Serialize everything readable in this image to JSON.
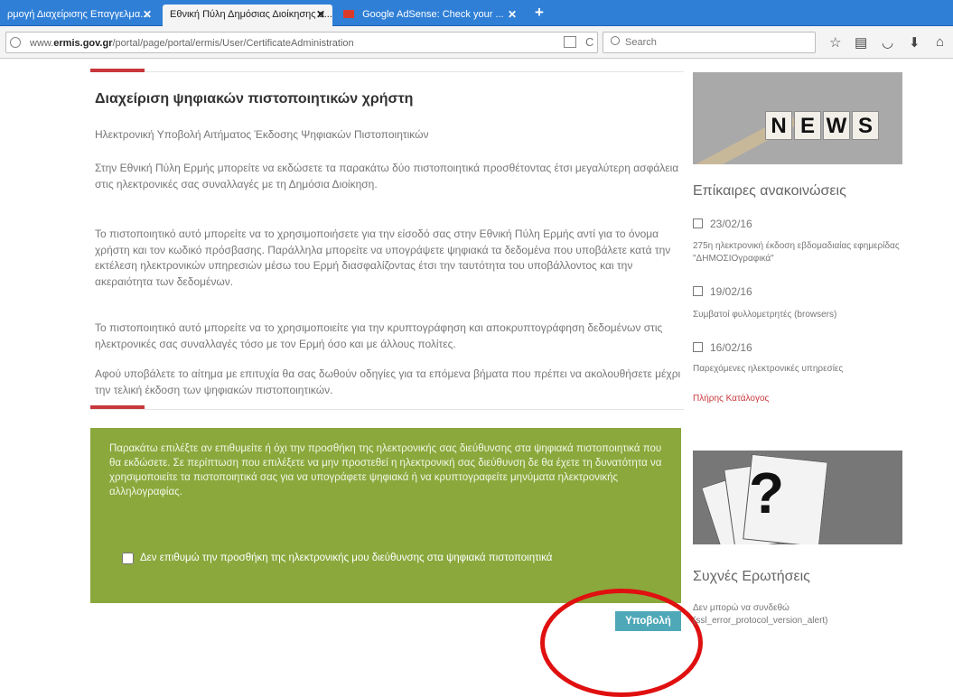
{
  "browser": {
    "tabs": [
      {
        "label": "ρμογή Διαχείρισης Επαγγελμα...",
        "active": false
      },
      {
        "label": "Εθνική Πύλη Δημόσιας Διοίκησης e...",
        "active": true
      },
      {
        "label": "Google AdSense: Check your ...",
        "active": false
      }
    ],
    "close_glyph": "✕",
    "new_tab_glyph": "+",
    "url_prefix": "www.",
    "url_domain": "ermis.gov.gr",
    "url_path": "/portal/page/portal/ermis/User/CertificateAdministration",
    "search_placeholder": "Search",
    "accent_color": "#2f7fd6"
  },
  "page": {
    "title": "Διαχείριση ψηφιακών πιστοποιητικών χρήστη",
    "subtitle": "Ηλεκτρονική Υποβολή Αιτήματος Έκδοσης Ψηφιακών Πιστοποιητικών",
    "paragraphs": [
      "Στην Εθνική Πύλη Ερμής μπορείτε να εκδώσετε τα παρακάτω δύο πιστοποιητικά προσθέτοντας έτσι μεγαλύτερη ασφάλεια στις ηλεκτρονικές σας συναλλαγές με τη Δημόσια Διοίκηση.",
      "Το πιστοποιητικό αυτό μπορείτε να το χρησιμοποιήσετε για την είσοδό σας στην Εθνική Πύλη Ερμής αντί για το όνομα χρήστη και τον κωδικό πρόσβασης. Παράλληλα μπορείτε να υπογράψετε ψηφιακά τα δεδομένα που υποβάλετε κατά την εκτέλεση ηλεκτρονικών υπηρεσιών μέσω του Ερμή διασφαλίζοντας έτσι την ταυτότητα του υποβάλλοντος και την ακεραιότητα των δεδομένων.",
      "Το πιστοποιητικό αυτό μπορείτε να το χρησιμοποιείτε για την κρυπτογράφηση και αποκρυπτογράφηση δεδομένων στις ηλεκτρονικές σας συναλλαγές τόσο με τον Ερμή όσο και με άλλους πολίτες.",
      "Αφού υποβάλετε το αίτημα με επιτυχία θα σας δωθούν οδηγίες για τα επόμενα βήματα που πρέπει να ακολουθήσετε μέχρι την τελική έκδοση των ψηφιακών πιστοποιητικών."
    ],
    "green_box_text": "Παρακάτω επιλέξτε αν επιθυμείτε ή όχι την προσθήκη της ηλεκτρονικής σας διεύθυνσης στα ψηφιακά πιστοποιητικά που θα εκδώσετε. Σε περίπτωση που επιλέξετε να μην προστεθεί η ηλεκτρονική σας διεύθυνση δε θα έχετε τη δυνατότητα να χρησιμοποιείτε τα πιστοποιητικά σας για να υπογράφετε ψηφιακά ή να κρυπτογραφείτε μηνύματα ηλεκτρονικής αλληλογραφίας.",
    "checkbox_label": "Δεν επιθυμώ την προσθήκη της ηλεκτρονικής μου διεύθυνσης στα ψηφιακά πιστοποιητικά",
    "checkbox_checked": false,
    "submit_label": "Υποβολή",
    "green_color": "#8aa83c",
    "accent_red": "#c8373c"
  },
  "sidebar": {
    "news_image_letters": [
      "N",
      "E",
      "W",
      "S"
    ],
    "news_heading": "Επίκαιρες ανακοινώσεις",
    "news": [
      {
        "date": "23/02/16",
        "text": "275η ηλεκτρονική έκδοση εβδομαδιαίας εφημερίδας \"ΔΗΜΟΣΙΟγραφικά\""
      },
      {
        "date": "19/02/16",
        "text": "Συμβατοί φυλλομετρητές (browsers)"
      },
      {
        "date": "16/02/16",
        "text": "Παρεχόμενες ηλεκτρονικές υπηρεσίες"
      }
    ],
    "news_all_link": "Πλήρης Κατάλογος",
    "faq_image_glyph": "?",
    "faq_heading": "Συχνές Ερωτήσεις",
    "faq_text": "Δεν μπορώ να συνδεθώ (ssl_error_protocol_version_alert)"
  }
}
